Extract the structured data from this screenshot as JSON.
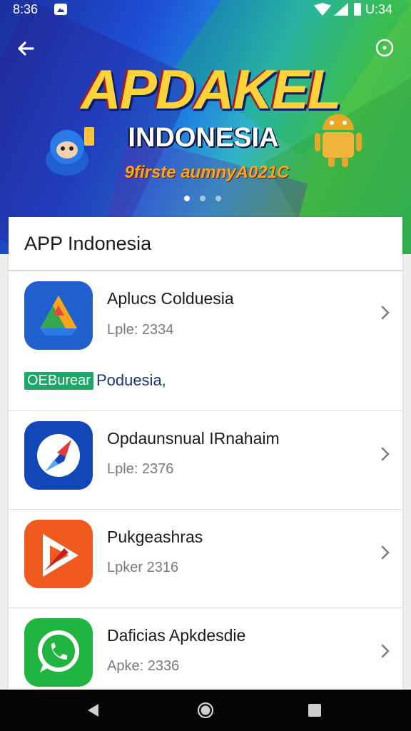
{
  "status_bar": {
    "time": "8:36",
    "time_right": "U:34",
    "icons": [
      "image-notification-icon",
      "wifi-icon",
      "signal-icon",
      "battery-icon"
    ]
  },
  "banner": {
    "title": "APDAKEL",
    "subtitle": "INDONESIA",
    "tagline": "9firste aumnyA021C",
    "carousel_pages": 3,
    "active_page": 1,
    "back_icon": "arrow-left-icon",
    "settings_icon": "settings-circle-icon"
  },
  "list": {
    "header": "APP Indonesia",
    "chevron_icon": "chevron-right-icon",
    "items": [
      {
        "name": "Aplucs Colduesia",
        "meta": "Lple: 2334",
        "icon": "drive-triangle-icon",
        "icon_color": "#1e63d2"
      },
      {
        "name": "Opdaunsnual IRnahaim",
        "meta": "Lple: 2376",
        "icon": "rocket-icon",
        "icon_color": "#1347b8"
      },
      {
        "name": "Pukgeashras",
        "meta": "Lpker 2316",
        "icon": "play-triangle-icon",
        "icon_color": "#f05a1f"
      },
      {
        "name": "Daficias Apkdesdie",
        "meta": "Apke: 2336",
        "icon": "whatsapp-icon",
        "icon_color": "#20b540"
      }
    ],
    "tag": {
      "label": "OEBurear",
      "text": "Poduesia,"
    }
  },
  "nav_bar": {
    "icons": [
      "back-triangle-icon",
      "home-circle-icon",
      "recents-square-icon"
    ]
  }
}
